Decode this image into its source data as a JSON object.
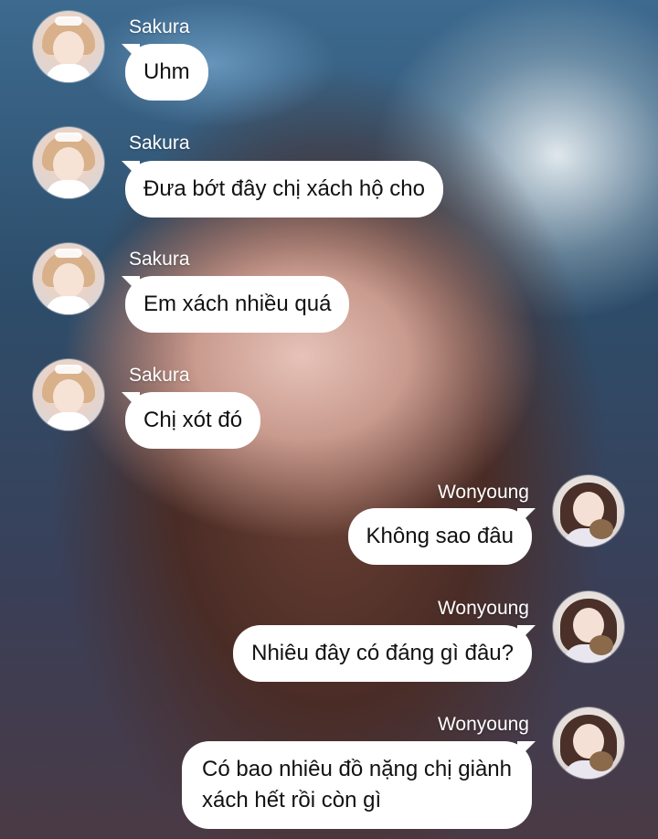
{
  "messages": [
    {
      "sender": "Sakura",
      "text": "Uhm"
    },
    {
      "sender": "Sakura",
      "text": "Đưa bớt đây chị xách hộ cho"
    },
    {
      "sender": "Sakura",
      "text": "Em xách nhiều quá"
    },
    {
      "sender": "Sakura",
      "text": "Chị xót đó"
    },
    {
      "sender": "Wonyoung",
      "text": "Không sao đâu"
    },
    {
      "sender": "Wonyoung",
      "text": "Nhiêu đây có đáng gì đâu?"
    },
    {
      "sender": "Wonyoung",
      "line1": "Có bao nhiêu đồ nặng chị giành",
      "line2": "xách hết rồi còn gì"
    }
  ]
}
